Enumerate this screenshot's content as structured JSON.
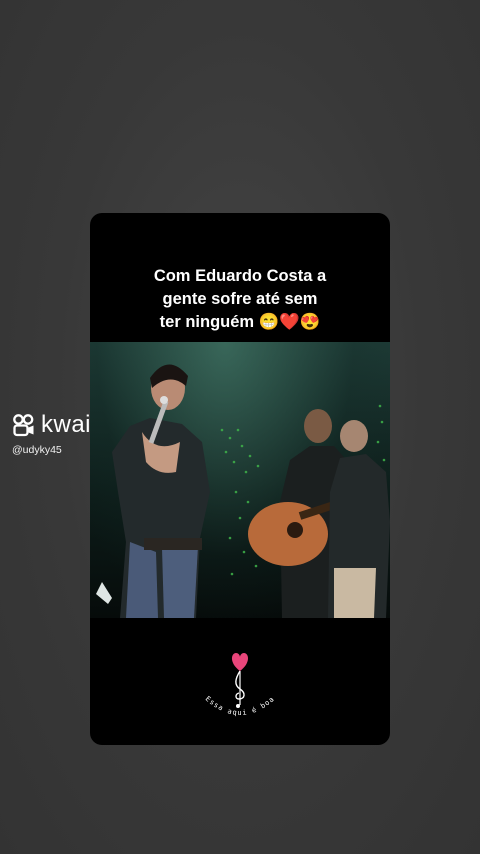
{
  "caption": {
    "line1": "Com Eduardo Costa a",
    "line2": "gente sofre até  sem",
    "line3": "ter ninguém 😁❤️😍"
  },
  "watermark": {
    "brand": "kwai",
    "handle": "@udyky45"
  },
  "logo": {
    "text": "Essa aqui é boa",
    "heart_color": "#e8457a"
  },
  "video": {
    "description_icon": "concert-video-frame"
  }
}
